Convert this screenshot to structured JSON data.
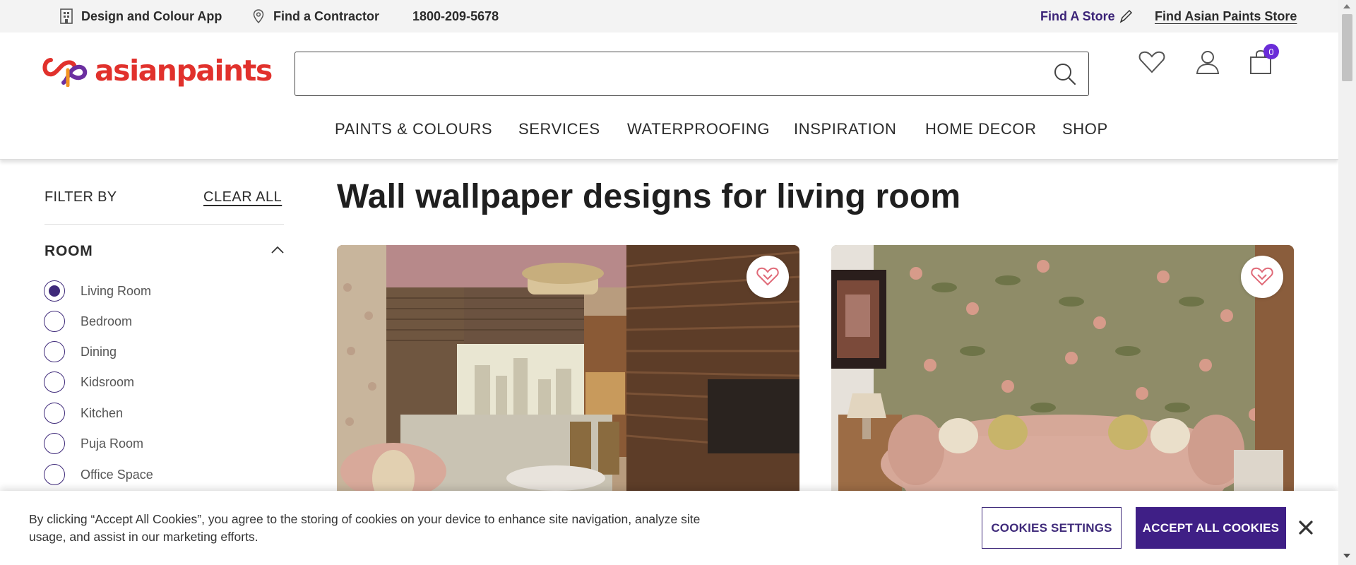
{
  "topbar": {
    "design_app_label": "Design and Colour App",
    "design_app_icon": "building-icon",
    "contractor_label": "Find a Contractor",
    "contractor_icon": "map-pin-icon",
    "phone": "1800-209-5678",
    "find_store_label": "Find A Store",
    "find_store_icon": "pencil-icon",
    "find_ap_store_label": "Find Asian Paints Store"
  },
  "header": {
    "logo_text": "asianpaints",
    "search": {
      "placeholder": "",
      "value": ""
    },
    "icons": [
      "heart-icon",
      "user-icon",
      "shopping-bag-icon"
    ],
    "cart_count": "0"
  },
  "nav": {
    "items": [
      "PAINTS & COLOURS",
      "SERVICES",
      "WATERPROOFING",
      "INSPIRATION",
      "HOME DECOR",
      "SHOP"
    ]
  },
  "filter": {
    "title": "FILTER BY",
    "clear_all": "CLEAR ALL",
    "room_heading": "ROOM",
    "room_options": [
      {
        "label": "Living Room",
        "selected": true
      },
      {
        "label": "Bedroom",
        "selected": false
      },
      {
        "label": "Dining",
        "selected": false
      },
      {
        "label": "Kidsroom",
        "selected": false
      },
      {
        "label": "Kitchen",
        "selected": false
      },
      {
        "label": "Puja Room",
        "selected": false
      },
      {
        "label": "Office Space",
        "selected": false
      }
    ]
  },
  "main": {
    "title": "Wall wallpaper designs for living room",
    "cards": [
      {
        "image": "living-room-wood-panel-scene",
        "favorite_icon": "heart-icon"
      },
      {
        "image": "living-room-floral-wallpaper-scene",
        "favorite_icon": "heart-icon"
      }
    ]
  },
  "cookie": {
    "text": "By clicking “Accept All Cookies”, you agree to the storing of cookies on your device to enhance site navigation, analyze site usage, and assist in our marketing efforts.",
    "settings_label": "COOKIES SETTINGS",
    "accept_label": "ACCEPT ALL COOKIES",
    "close_icon": "close-icon"
  },
  "colors": {
    "brand_purple": "#3f1f86",
    "logo_red": "#e1312c",
    "accent_violet": "#6a2cd8",
    "heart_pink": "#e06a78"
  }
}
